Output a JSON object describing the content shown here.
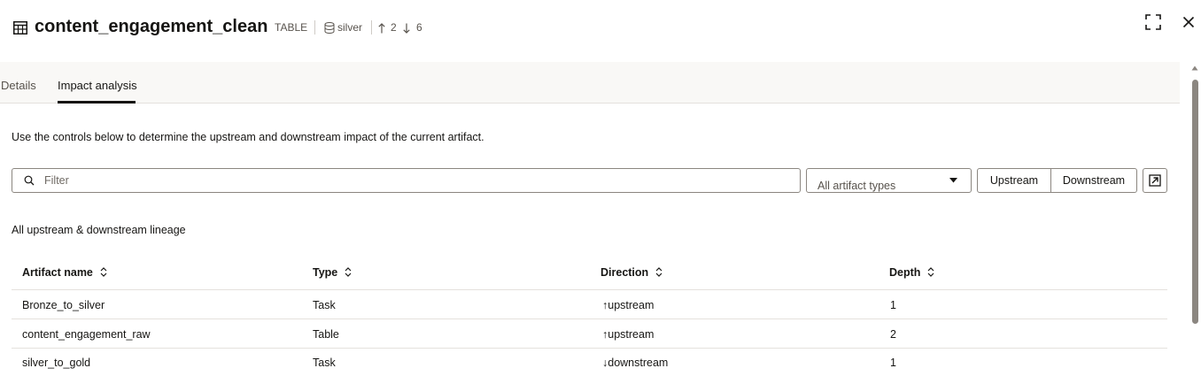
{
  "header": {
    "title": "content_engagement_clean",
    "type_label": "TABLE",
    "schema": "silver",
    "upstream_count": "2",
    "downstream_count": "6",
    "icons": {
      "title": "table-icon",
      "schema": "database-icon",
      "upstream": "arrow-up-icon",
      "downstream": "arrow-down-icon",
      "fullscreen": "fullscreen-icon",
      "close": "close-icon"
    }
  },
  "tabs": [
    {
      "label": "Details",
      "active": false
    },
    {
      "label": "Impact analysis",
      "active": true
    }
  ],
  "description": "Use the controls below to determine the upstream and downstream impact of the current artifact.",
  "controls": {
    "filter_placeholder": "Filter",
    "filter_value": "",
    "artifact_type_selected": "All artifact types",
    "upstream_label": "Upstream",
    "downstream_label": "Downstream",
    "expand_icon": "open-in-new-icon"
  },
  "lineage_label": "All upstream & downstream lineage",
  "table": {
    "columns": [
      "Artifact name",
      "Type",
      "Direction",
      "Depth"
    ],
    "rows": [
      {
        "name": "Bronze_to_silver",
        "type": "Task",
        "direction": "upstream",
        "direction_symbol": "↑",
        "depth": "1"
      },
      {
        "name": "content_engagement_raw",
        "type": "Table",
        "direction": "upstream",
        "direction_symbol": "↑",
        "depth": "2"
      },
      {
        "name": "silver_to_gold",
        "type": "Task",
        "direction": "downstream",
        "direction_symbol": "↓",
        "depth": "1"
      }
    ]
  },
  "colors": {
    "text": "#161513",
    "muted": "#58534d",
    "border": "#8b8680",
    "tab_bar_bg": "#f9f8f6",
    "divider": "#e4e1dd"
  }
}
